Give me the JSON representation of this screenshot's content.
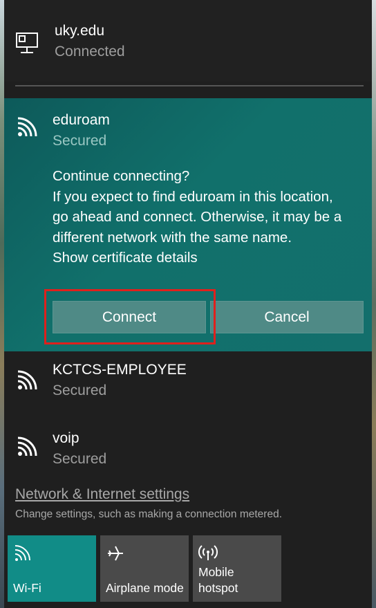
{
  "wired": {
    "name": "uky.edu",
    "status": "Connected"
  },
  "expanded_network": {
    "name": "eduroam",
    "status": "Secured",
    "prompt_lines": [
      "Continue connecting?",
      "If you expect to find eduroam in this location,",
      "go ahead and connect. Otherwise, it may be a",
      "different network with the same name.",
      "Show certificate details"
    ],
    "connect_label": "Connect",
    "cancel_label": "Cancel"
  },
  "networks": [
    {
      "name": "KCTCS-EMPLOYEE",
      "status": "Secured"
    },
    {
      "name": "voip",
      "status": "Secured"
    }
  ],
  "settings": {
    "link_label": "Network & Internet settings",
    "subtitle": "Change settings, such as making a connection metered."
  },
  "quick_actions": [
    {
      "label": "Wi-Fi",
      "icon": "wifi-icon",
      "active": true
    },
    {
      "label": "Airplane mode",
      "icon": "airplane-icon",
      "active": false
    },
    {
      "label_line1": "Mobile",
      "label_line2": "hotspot",
      "icon": "hotspot-icon",
      "active": false
    }
  ],
  "colors": {
    "accent": "#118c87",
    "expanded_bg": "#11706b",
    "highlight": "#e0201c"
  }
}
